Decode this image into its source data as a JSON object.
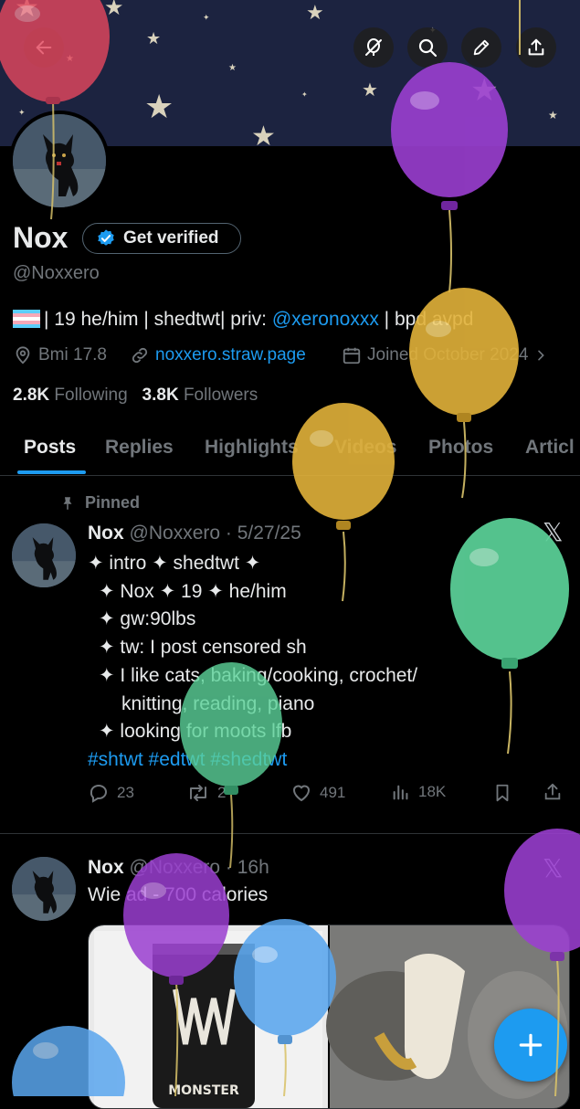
{
  "profile": {
    "name": "Nox",
    "verify_label": "Get verified",
    "handle": "@Noxxero",
    "bio_text": "| 19 he/him | shedtwt| priv: ",
    "bio_link": "@xeronoxxx",
    "bio_tail": " | bpd avpd",
    "location": "Bmi 17.8",
    "website": "noxxero.straw.page",
    "joined": "Joined October 2024",
    "following_count": "2.8K",
    "following_label": "Following",
    "followers_count": "3.8K",
    "followers_label": "Followers"
  },
  "tabs": [
    "Posts",
    "Replies",
    "Highlights",
    "Videos",
    "Photos",
    "Articl"
  ],
  "pinned_post": {
    "pinned_label": "Pinned",
    "author": "Nox",
    "handle_date": "@Noxxero · 5/27/25",
    "lines": [
      "✦ intro ✦ shedtwt ✦",
      "✦ Nox ✦ 19 ✦ he/him",
      "✦ gw:90lbs",
      "✦ tw: I post censored sh",
      "✦ I like cats, baking/cooking, crochet/",
      "knitting, reading, piano",
      "✦ looking for moots lfb"
    ],
    "hashtags": "#shtwt #edtwt #shedtwt",
    "replies": "23",
    "reposts": "2",
    "likes": "491",
    "views": "18K"
  },
  "post2": {
    "author": "Nox",
    "handle_date": "@Noxxero · 16h",
    "text": "Wie ad - 700 calories",
    "can_label": "MONSTER"
  },
  "icons": [
    "back-arrow-icon",
    "no-balloon-icon",
    "search-icon",
    "edit-icon",
    "share-icon",
    "verified-badge-icon",
    "location-icon",
    "link-icon",
    "calendar-icon",
    "chevron-right-icon",
    "pin-icon",
    "x-logo-icon",
    "reply-icon",
    "repost-icon",
    "like-icon",
    "views-icon",
    "bookmark-icon",
    "plus-icon"
  ],
  "colors": {
    "accent": "#1d9bf0",
    "background": "#000000",
    "muted": "#71767b",
    "text": "#e7e9ea"
  }
}
